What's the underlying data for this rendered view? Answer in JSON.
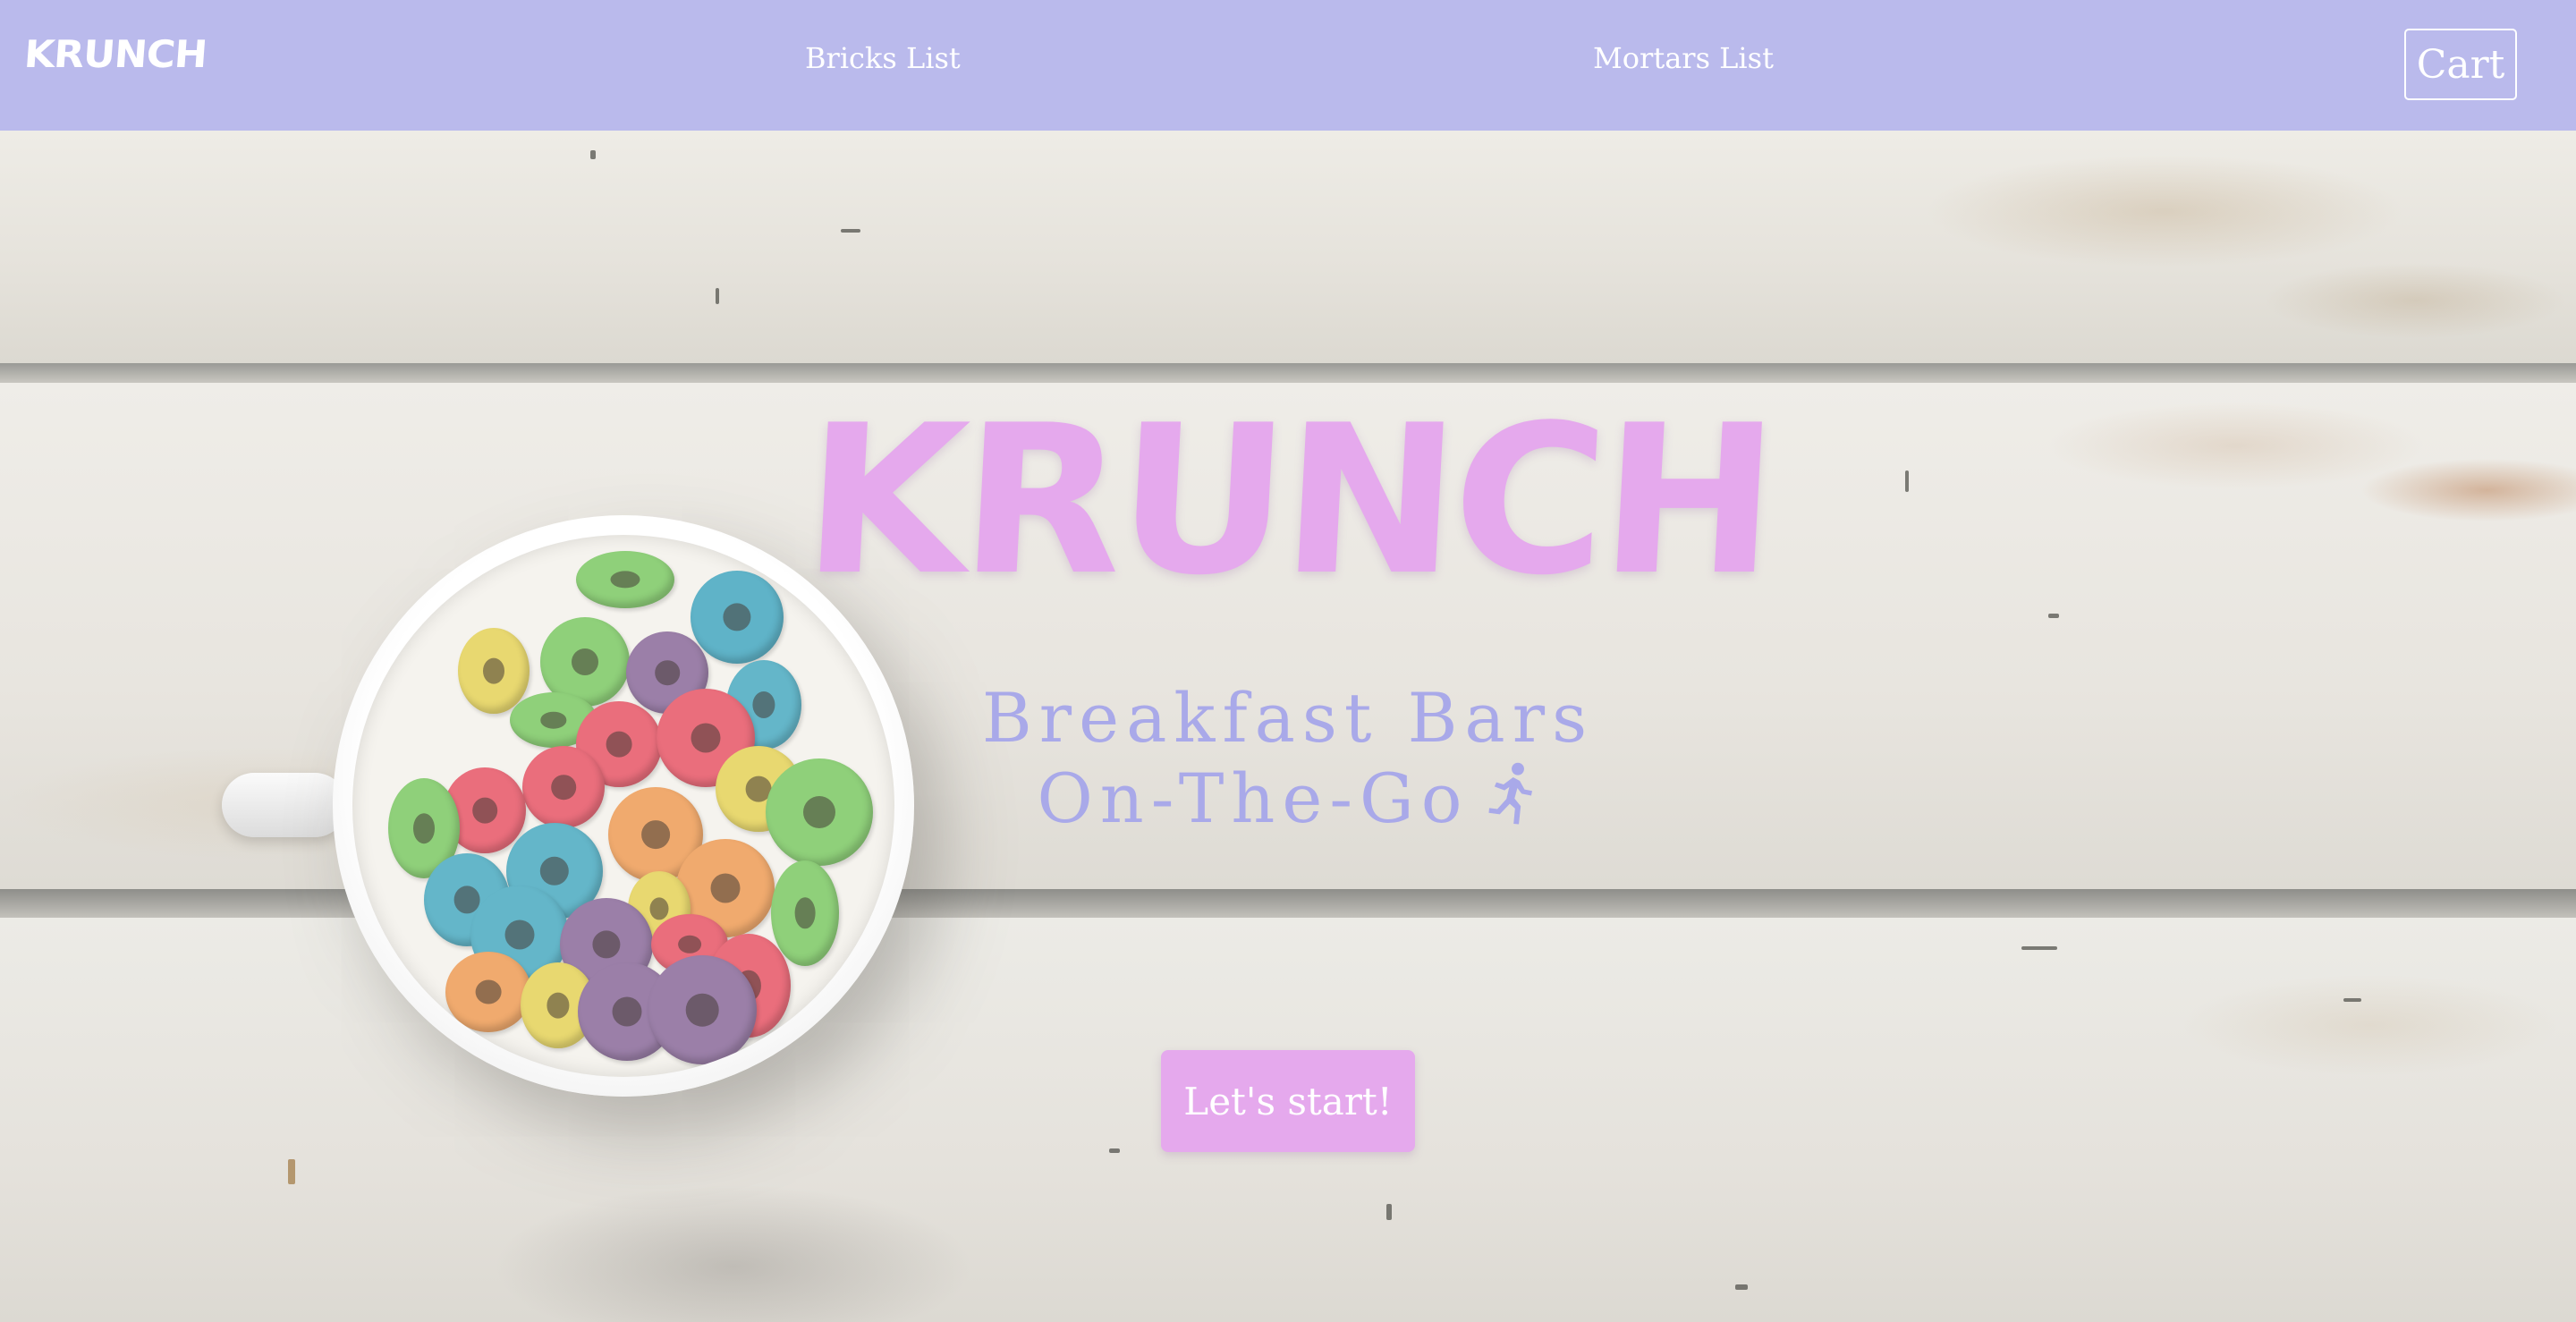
{
  "nav": {
    "brand": "KRUNCH",
    "links": [
      {
        "label": "Bricks List"
      },
      {
        "label": "Mortars List"
      }
    ],
    "cart_label": "Cart",
    "background_color": "#babaec"
  },
  "hero": {
    "title": "KRUNCH",
    "tagline_line1": "Breakfast Bars",
    "tagline_line2": "On-The-Go",
    "tagline_icon": "running-person-icon",
    "cta_label": "Let's start!",
    "title_color": "#e5a9ed",
    "tagline_color": "#a9a9e9",
    "cta_color": "#e5a9ed",
    "background_image": "cereal-cup-on-white-wood"
  }
}
